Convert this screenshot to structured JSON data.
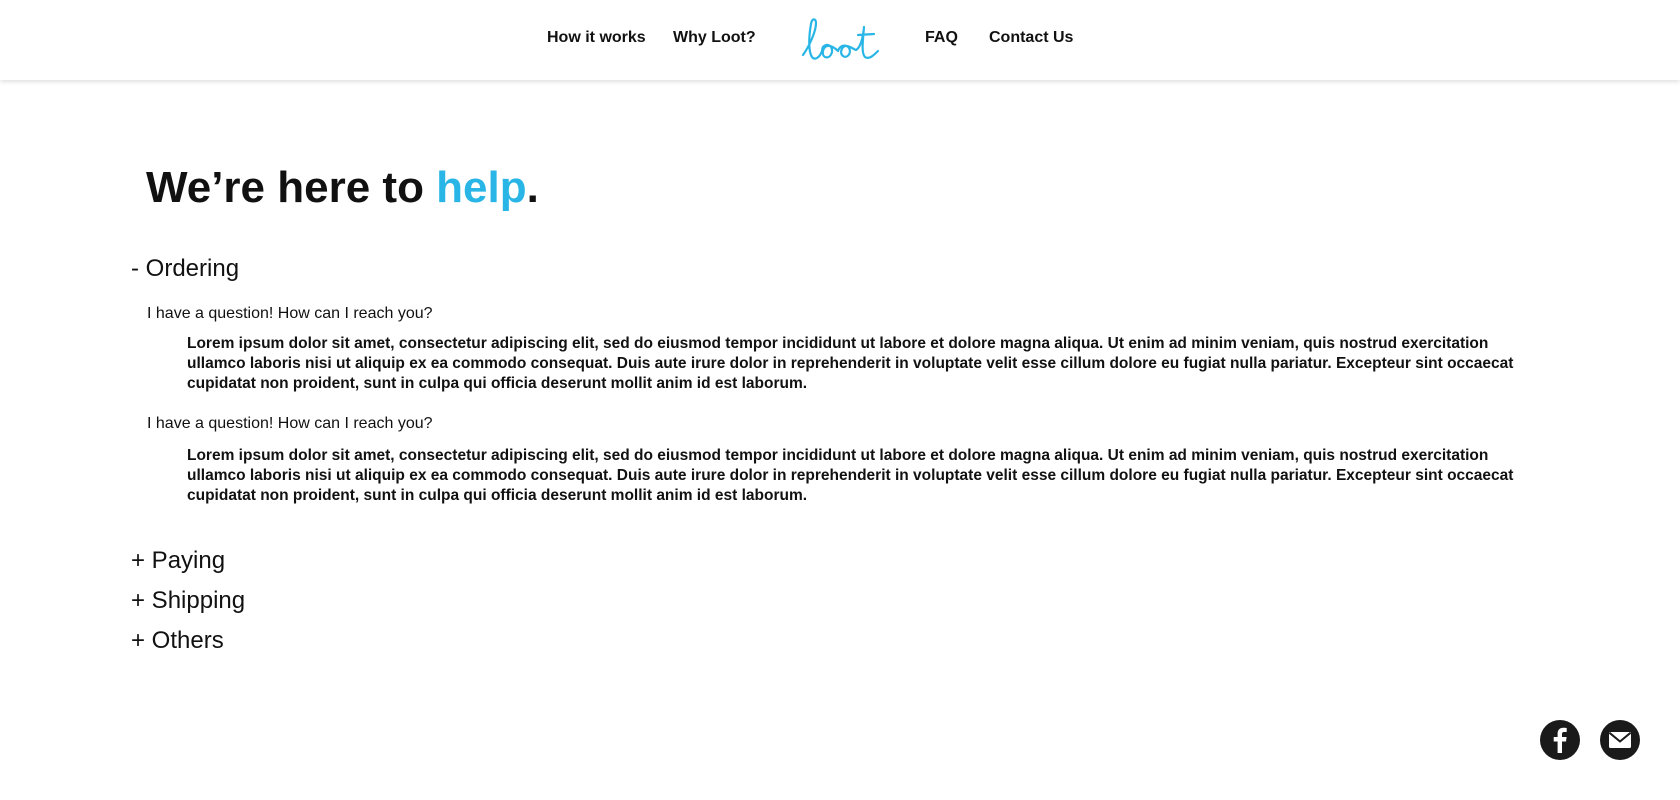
{
  "nav": {
    "left_items": [
      {
        "label": "How it works"
      },
      {
        "label": "Why Loot?"
      }
    ],
    "logo_text": "loot",
    "right_items": [
      {
        "label": "FAQ"
      },
      {
        "label": "Contact Us"
      }
    ]
  },
  "title": {
    "prefix": "We’re here to ",
    "accent": "help",
    "suffix": "."
  },
  "sections": [
    {
      "label": "- Ordering",
      "questions": [
        {
          "question": "I have a question! How can I reach you?",
          "answer": "Lorem ipsum dolor sit amet, consectetur adipiscing elit, sed do eiusmod tempor incididunt ut labore et dolore magna aliqua. Ut enim ad minim veniam, quis nostrud exercitation ullamco laboris nisi ut aliquip ex ea commodo consequat. Duis aute irure dolor in reprehenderit in voluptate velit esse cillum dolore eu fugiat nulla pariatur. Excepteur sint occaecat cupidatat non proident, sunt in culpa qui officia deserunt mollit anim id est laborum."
        },
        {
          "question": "I have a question! How can I reach you?",
          "answer": "Lorem ipsum dolor sit amet, consectetur adipiscing elit, sed do eiusmod tempor incididunt ut labore et dolore magna aliqua. Ut enim ad minim veniam, quis nostrud exercitation ullamco laboris nisi ut aliquip ex ea commodo consequat. Duis aute irure dolor in reprehenderit in voluptate velit esse cillum dolore eu fugiat nulla pariatur. Excepteur sint occaecat cupidatat non proident, sunt in culpa qui officia deserunt mollit anim id est laborum."
        }
      ]
    },
    {
      "label": "+ Paying"
    },
    {
      "label": "+ Shipping"
    },
    {
      "label": "+ Others"
    }
  ],
  "social": {
    "icons": [
      "facebook-icon",
      "mail-icon"
    ]
  },
  "colors": {
    "accent": "#29b6e6",
    "text": "#111111",
    "icon_bg": "#1a1a1a"
  }
}
